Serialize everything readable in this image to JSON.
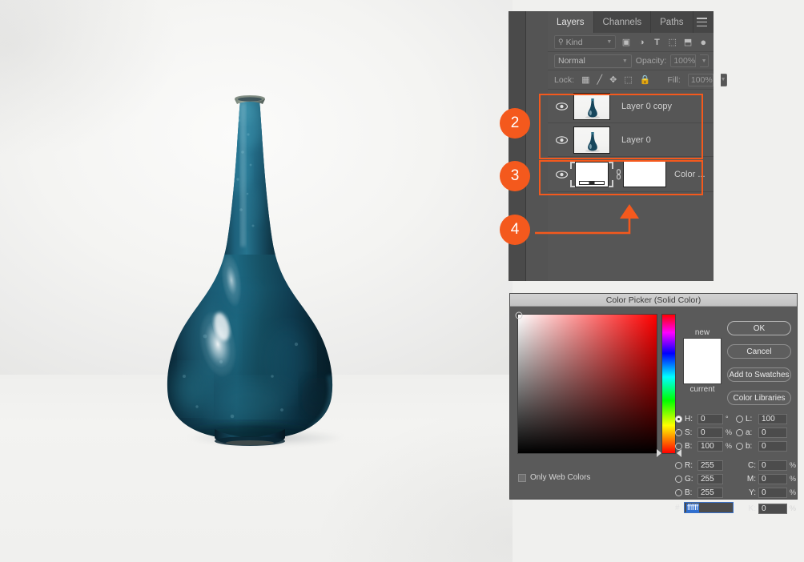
{
  "photo": {
    "alt_description": "Dark teal blue ceramic bottle vase on light gray studio background",
    "vase_body_color": "#15475c",
    "vase_highlight_color": "#dfe9ee",
    "background_color": "#f1f1ef"
  },
  "annotations": {
    "badges": [
      {
        "number": "2",
        "target": "layer-rows-highlight"
      },
      {
        "number": "3",
        "target": "solid-color-layer-highlight"
      },
      {
        "number": "4",
        "target": "new-fill-adjustment-layer-button"
      }
    ],
    "accent_color": "#f4591d"
  },
  "layers_panel": {
    "tabs": [
      {
        "label": "Layers",
        "active": true
      },
      {
        "label": "Channels",
        "active": false
      },
      {
        "label": "Paths",
        "active": false
      }
    ],
    "menu_icon": "hamburger-menu-icon",
    "filter_row": {
      "search_icon": "magnifier-icon",
      "kind_label": "Kind",
      "chevron": "▼",
      "filter_icons": [
        {
          "name": "pixel-layer-filter-icon",
          "glyph": "▣"
        },
        {
          "name": "adjustment-layer-filter-icon",
          "glyph": "◑"
        },
        {
          "name": "type-layer-filter-icon",
          "glyph": "T"
        },
        {
          "name": "shape-layer-filter-icon",
          "glyph": "⬚"
        },
        {
          "name": "smart-object-filter-icon",
          "glyph": "⬒"
        },
        {
          "name": "filter-toggle-icon",
          "glyph": "●"
        }
      ]
    },
    "blend_row": {
      "blend_mode": "Normal",
      "opacity_label": "Opacity:",
      "opacity_value": "100%",
      "chevron": "▼"
    },
    "lock_row": {
      "lock_label": "Lock:",
      "lock_icons": [
        {
          "name": "lock-transparent-pixels-icon",
          "glyph": "☒"
        },
        {
          "name": "lock-image-pixels-icon",
          "glyph": "╱"
        },
        {
          "name": "lock-position-icon",
          "glyph": "✥"
        },
        {
          "name": "lock-artboard-nesting-icon",
          "glyph": "⬚"
        },
        {
          "name": "lock-all-icon",
          "glyph": "🔒"
        }
      ],
      "fill_label": "Fill:",
      "fill_value": "100%"
    },
    "layers": [
      {
        "name": "Layer 0 copy",
        "visible": true,
        "eye_icon": "eye-icon",
        "thumbnail": "vase-thumbnail",
        "type": "pixel"
      },
      {
        "name": "Layer 0",
        "visible": true,
        "eye_icon": "eye-icon",
        "thumbnail": "vase-thumbnail",
        "type": "pixel"
      },
      {
        "name": "Color ...",
        "visible": true,
        "eye_icon": "eye-icon",
        "thumbnail": "solid-color-swatch",
        "mask": "layer-mask-white",
        "link_icon": "link-chain-icon",
        "type": "solid-color-fill",
        "selected": true
      }
    ]
  },
  "color_picker": {
    "title": "Color Picker (Solid Color)",
    "buttons": [
      {
        "label": "OK",
        "primary": true
      },
      {
        "label": "Cancel",
        "primary": false
      },
      {
        "label": "Add to Swatches",
        "primary": false
      },
      {
        "label": "Color Libraries",
        "primary": false
      }
    ],
    "swatches": {
      "new_label": "new",
      "current_label": "current",
      "new_color": "#ffffff",
      "current_color": "#ffffff"
    },
    "only_web_colors": {
      "label": "Only Web Colors",
      "checked": false
    },
    "hsb": [
      {
        "key": "H:",
        "value": "0",
        "unit": "°",
        "selected": true
      },
      {
        "key": "S:",
        "value": "0",
        "unit": "%",
        "selected": false
      },
      {
        "key": "B:",
        "value": "100",
        "unit": "%",
        "selected": false
      }
    ],
    "rgb": [
      {
        "key": "R:",
        "value": "255",
        "unit": "",
        "selected": false
      },
      {
        "key": "G:",
        "value": "255",
        "unit": "",
        "selected": false
      },
      {
        "key": "B:",
        "value": "255",
        "unit": "",
        "selected": false
      }
    ],
    "lab": [
      {
        "key": "L:",
        "value": "100",
        "unit": "",
        "selected": false
      },
      {
        "key": "a:",
        "value": "0",
        "unit": "",
        "selected": false
      },
      {
        "key": "b:",
        "value": "0",
        "unit": "",
        "selected": false
      }
    ],
    "cmyk": [
      {
        "key": "C:",
        "value": "0",
        "unit": "%"
      },
      {
        "key": "M:",
        "value": "0",
        "unit": "%"
      },
      {
        "key": "Y:",
        "value": "0",
        "unit": "%"
      },
      {
        "key": "K:",
        "value": "0",
        "unit": "%"
      }
    ],
    "hex": {
      "hash": "#",
      "value": "ffffff",
      "selected": true
    },
    "sb_marker": {
      "x_pct": 0,
      "y_pct": 0
    },
    "hue_marker_pct": 100
  }
}
